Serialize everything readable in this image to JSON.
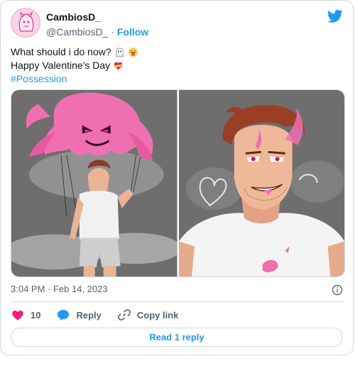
{
  "tweet": {
    "author_name": "CambiosD_",
    "author_handle": "@CambiosD_",
    "separator": "·",
    "follow_label": "Follow",
    "text_line1": "What should i do now?",
    "text_line2": "Happy Valentine's Day",
    "hashtag": "#Possession",
    "timestamp": "3:04 PM · Feb 14, 2023",
    "like_count": "10",
    "reply_label": "Reply",
    "copy_link_label": "Copy link",
    "read_replies_label": "Read 1 reply"
  },
  "icons": {
    "brand": "twitter-bird-icon",
    "like": "heart-icon",
    "reply": "speech-bubble-icon",
    "copy": "link-icon",
    "info": "info-icon",
    "emoji1": "ghost-emoji",
    "emoji2": "tongue-face-emoji",
    "emoji3": "heart-ribbon-emoji"
  },
  "colors": {
    "accent": "#1d9bf0",
    "like": "#f91880",
    "text": "#0f1419",
    "muted": "#536471",
    "border": "#cfd9de"
  }
}
